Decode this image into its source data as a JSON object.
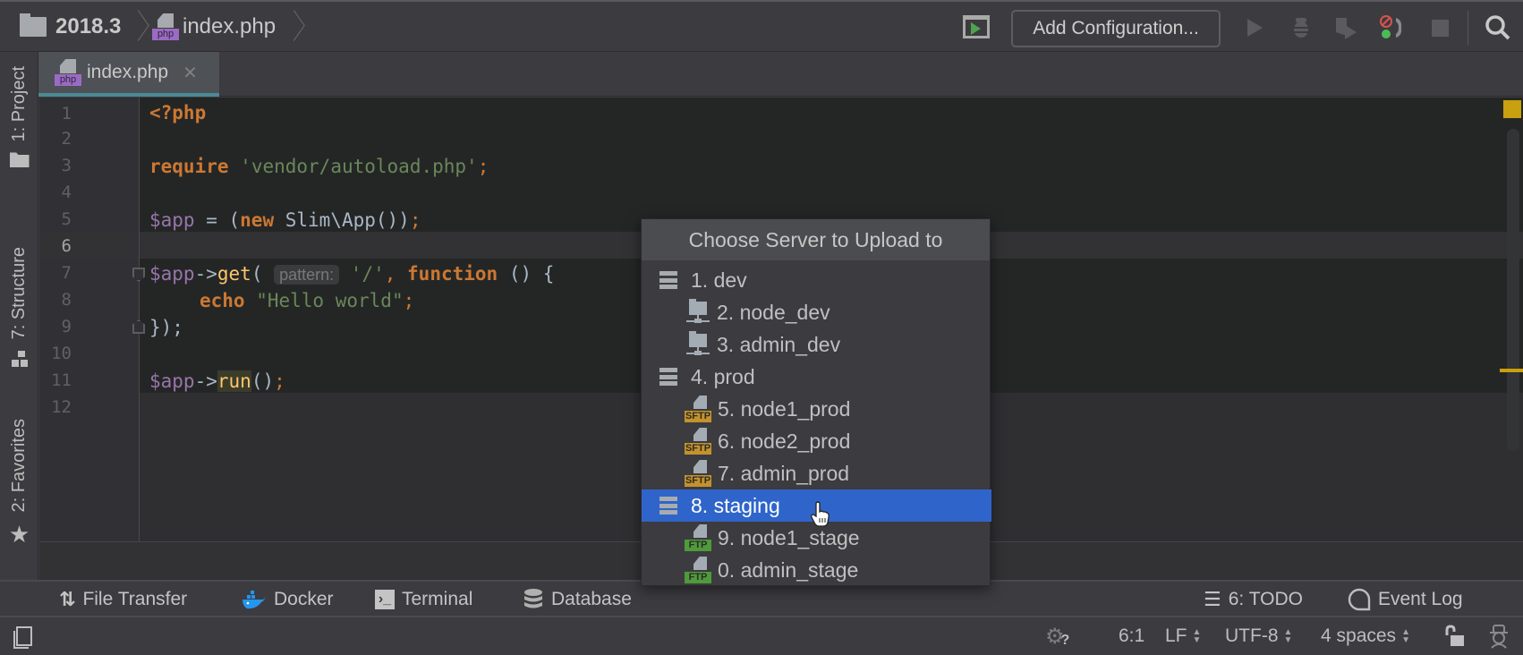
{
  "navbar": {
    "project": "2018.3",
    "file": "index.php",
    "file_icon_label": "php",
    "add_configuration": "Add Configuration..."
  },
  "tabs": [
    {
      "label": "index.php",
      "icon_label": "php",
      "active": true
    }
  ],
  "left_stripe": {
    "project": "1: Project",
    "structure": "7: Structure",
    "favorites": "2: Favorites"
  },
  "editor": {
    "line_numbers": [
      "1",
      "2",
      "3",
      "4",
      "5",
      "6",
      "7",
      "8",
      "9",
      "10",
      "11",
      "12"
    ],
    "current_line": 6,
    "lines": {
      "l1": "<?php",
      "l3_kw": "require",
      "l3_str": "'vendor/autoload.php'",
      "l3_semi": ";",
      "l5_var": "$app",
      "l5_eq": " = (",
      "l5_kw": "new",
      "l5_rest": " Slim\\App())",
      "l5_semi": ";",
      "l7_var": "$app",
      "l7_arrow": "->",
      "l7_fn": "get",
      "l7_paren": "( ",
      "l7_hint": "pattern:",
      "l7_str": " '/'",
      "l7_comma": ",",
      "l7_kw": " function",
      "l7_rest": " () {",
      "l8_kw": "echo",
      "l8_str": " \"Hello world\"",
      "l8_semi": ";",
      "l9": "});",
      "l11_var": "$app",
      "l11_arrow": "->",
      "l11_fn": "run",
      "l11_rest": "()",
      "l11_semi": ";"
    }
  },
  "popup": {
    "title": "Choose Server to Upload to",
    "items": [
      {
        "label": "1. dev",
        "icon": "server-group-icon",
        "level": 0
      },
      {
        "label": "2. node_dev",
        "icon": "network-folder-icon",
        "level": 1
      },
      {
        "label": "3. admin_dev",
        "icon": "network-folder-icon",
        "level": 1
      },
      {
        "label": "4. prod",
        "icon": "server-group-icon",
        "level": 0
      },
      {
        "label": "5. node1_prod",
        "icon": "sftp-icon",
        "level": 1,
        "badge": "SFTP"
      },
      {
        "label": "6. node2_prod",
        "icon": "sftp-icon",
        "level": 1,
        "badge": "SFTP"
      },
      {
        "label": "7. admin_prod",
        "icon": "sftp-icon",
        "level": 1,
        "badge": "SFTP"
      },
      {
        "label": "8. staging",
        "icon": "server-group-icon",
        "level": 0,
        "selected": true
      },
      {
        "label": "9. node1_stage",
        "icon": "ftp-icon",
        "level": 1,
        "badge": "FTP"
      },
      {
        "label": "0. admin_stage",
        "icon": "ftp-icon",
        "level": 1,
        "badge": "FTP"
      }
    ]
  },
  "toolwindows": {
    "file_transfer": "File Transfer",
    "docker": "Docker",
    "terminal": "Terminal",
    "database": "Database",
    "todo": "6: TODO",
    "event_log": "Event Log"
  },
  "statusbar": {
    "position": "6:1",
    "line_sep": "LF",
    "encoding": "UTF-8",
    "indent": "4 spaces"
  },
  "colors": {
    "selection": "#2f65ca",
    "keyword": "#cc7832",
    "string": "#6a8759",
    "variable": "#9876aa",
    "function": "#ffc66d",
    "sftp_badge": "#c4922b",
    "ftp_badge": "#4f9a3b",
    "warning_marker": "#c9a010"
  }
}
